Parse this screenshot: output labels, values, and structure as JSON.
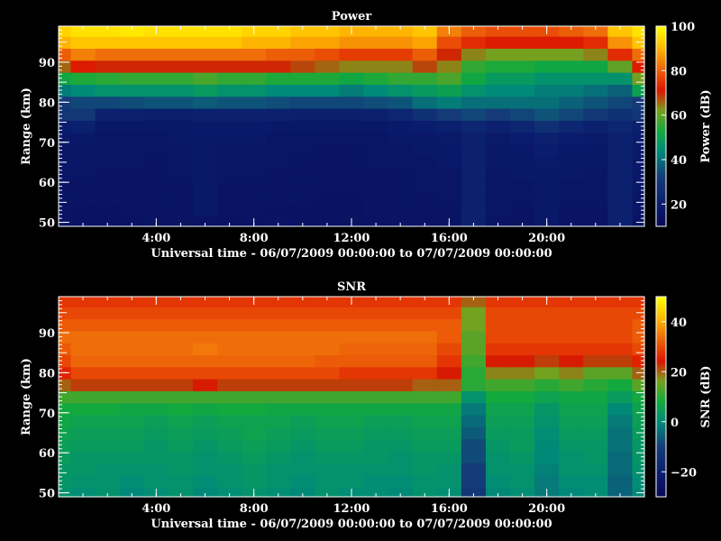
{
  "chart_data": [
    {
      "type": "heatmap",
      "title": "Power",
      "xlabel": "Universal time - 06/07/2009 00:00:00 to 07/07/2009 00:00:00",
      "ylabel": "Range (km)",
      "x_range_hours": [
        0,
        24
      ],
      "ylim": [
        49,
        99
      ],
      "x_ticks": [
        {
          "v": 4,
          "label": "4:00"
        },
        {
          "v": 8,
          "label": "8:00"
        },
        {
          "v": 12,
          "label": "12:00"
        },
        {
          "v": 16,
          "label": "16:00"
        },
        {
          "v": 20,
          "label": "20:00"
        }
      ],
      "y_ticks": [
        {
          "v": 50,
          "label": "50"
        },
        {
          "v": 60,
          "label": "60"
        },
        {
          "v": 70,
          "label": "70"
        },
        {
          "v": 80,
          "label": "80"
        },
        {
          "v": 90,
          "label": "90"
        }
      ],
      "colorbar": {
        "label": "Power (dB)",
        "range": [
          10,
          100
        ],
        "ticks": [
          {
            "v": 20,
            "label": "20"
          },
          {
            "v": 40,
            "label": "40"
          },
          {
            "v": 60,
            "label": "60"
          },
          {
            "v": 80,
            "label": "80"
          },
          {
            "v": 100,
            "label": "100"
          }
        ]
      },
      "range_gates_km": [
        50,
        53,
        56,
        59,
        62,
        65,
        68,
        71,
        74,
        77,
        80,
        83,
        86,
        89,
        92,
        95,
        98
      ],
      "times_hours": [
        0,
        1,
        2,
        3,
        4,
        5,
        6,
        7,
        8,
        9,
        10,
        11,
        12,
        13,
        14,
        15,
        16,
        17,
        18,
        19,
        20,
        21,
        22,
        23,
        24
      ],
      "z": [
        [
          15,
          15,
          15,
          15,
          16,
          16,
          15,
          15,
          15,
          16,
          15,
          15,
          15,
          15,
          16,
          15,
          16,
          22,
          16,
          16,
          18,
          16,
          16,
          22,
          16
        ],
        [
          16,
          15,
          15,
          16,
          16,
          16,
          18,
          16,
          16,
          15,
          15,
          15,
          15,
          16,
          16,
          16,
          16,
          22,
          17,
          16,
          18,
          16,
          16,
          22,
          17
        ],
        [
          16,
          16,
          16,
          16,
          16,
          16,
          18,
          16,
          16,
          16,
          16,
          15,
          15,
          16,
          16,
          16,
          17,
          22,
          17,
          17,
          18,
          17,
          17,
          22,
          17
        ],
        [
          16,
          16,
          16,
          16,
          16,
          16,
          18,
          16,
          16,
          16,
          16,
          16,
          16,
          16,
          16,
          17,
          17,
          22,
          17,
          17,
          18,
          17,
          17,
          22,
          18
        ],
        [
          17,
          17,
          16,
          16,
          16,
          17,
          18,
          17,
          17,
          16,
          16,
          16,
          16,
          16,
          16,
          17,
          17,
          22,
          17,
          18,
          18,
          18,
          17,
          22,
          18
        ],
        [
          17,
          17,
          17,
          17,
          16,
          17,
          18,
          17,
          17,
          17,
          16,
          16,
          16,
          17,
          17,
          17,
          18,
          22,
          18,
          18,
          19,
          18,
          18,
          22,
          18
        ],
        [
          17,
          17,
          17,
          17,
          17,
          17,
          18,
          17,
          17,
          17,
          17,
          16,
          16,
          17,
          17,
          18,
          18,
          22,
          18,
          18,
          20,
          18,
          18,
          22,
          19
        ],
        [
          18,
          18,
          17,
          17,
          17,
          18,
          18,
          18,
          18,
          17,
          17,
          17,
          17,
          17,
          18,
          18,
          19,
          22,
          19,
          20,
          22,
          20,
          19,
          22,
          20
        ],
        [
          20,
          22,
          18,
          18,
          18,
          18,
          19,
          19,
          19,
          18,
          18,
          18,
          18,
          18,
          19,
          20,
          21,
          24,
          22,
          24,
          28,
          24,
          22,
          24,
          22
        ],
        [
          30,
          30,
          22,
          22,
          21,
          21,
          22,
          22,
          22,
          22,
          21,
          21,
          21,
          22,
          24,
          28,
          32,
          34,
          32,
          34,
          36,
          34,
          30,
          28,
          30
        ],
        [
          32,
          34,
          34,
          35,
          36,
          36,
          37,
          36,
          36,
          35,
          34,
          34,
          34,
          35,
          36,
          40,
          42,
          40,
          40,
          40,
          40,
          38,
          36,
          34,
          32
        ],
        [
          42,
          44,
          46,
          46,
          46,
          46,
          48,
          46,
          46,
          44,
          44,
          44,
          42,
          44,
          46,
          48,
          50,
          46,
          44,
          44,
          42,
          42,
          40,
          38,
          50
        ],
        [
          52,
          54,
          55,
          56,
          56,
          56,
          58,
          56,
          56,
          54,
          54,
          54,
          52,
          54,
          56,
          56,
          58,
          52,
          48,
          48,
          46,
          46,
          46,
          46,
          62
        ],
        [
          66,
          72,
          70,
          70,
          70,
          70,
          70,
          70,
          70,
          70,
          68,
          66,
          64,
          64,
          64,
          68,
          64,
          56,
          54,
          54,
          52,
          52,
          52,
          60,
          72
        ],
        [
          80,
          84,
          82,
          82,
          82,
          82,
          82,
          82,
          82,
          80,
          80,
          78,
          76,
          76,
          76,
          80,
          70,
          64,
          62,
          62,
          62,
          62,
          64,
          74,
          82
        ],
        [
          90,
          92,
          92,
          92,
          92,
          92,
          92,
          92,
          90,
          90,
          88,
          88,
          86,
          86,
          86,
          88,
          78,
          74,
          72,
          72,
          72,
          72,
          74,
          86,
          92
        ],
        [
          94,
          96,
          96,
          97,
          96,
          96,
          96,
          96,
          94,
          94,
          92,
          92,
          90,
          90,
          90,
          92,
          84,
          80,
          78,
          78,
          78,
          80,
          82,
          92,
          96
        ]
      ]
    },
    {
      "type": "heatmap",
      "title": "SNR",
      "xlabel": "Universal time - 06/07/2009 00:00:00 to 07/07/2009 00:00:00",
      "ylabel": "Range (km)",
      "x_range_hours": [
        0,
        24
      ],
      "ylim": [
        49,
        99
      ],
      "x_ticks": [
        {
          "v": 4,
          "label": "4:00"
        },
        {
          "v": 8,
          "label": "8:00"
        },
        {
          "v": 12,
          "label": "12:00"
        },
        {
          "v": 16,
          "label": "16:00"
        },
        {
          "v": 20,
          "label": "20:00"
        }
      ],
      "y_ticks": [
        {
          "v": 50,
          "label": "50"
        },
        {
          "v": 60,
          "label": "60"
        },
        {
          "v": 70,
          "label": "70"
        },
        {
          "v": 80,
          "label": "80"
        },
        {
          "v": 90,
          "label": "90"
        }
      ],
      "colorbar": {
        "label": "SNR (dB)",
        "range": [
          -30,
          50
        ],
        "ticks": [
          {
            "v": -20,
            "label": "−20"
          },
          {
            "v": 0,
            "label": "0"
          },
          {
            "v": 20,
            "label": "20"
          },
          {
            "v": 40,
            "label": "40"
          }
        ]
      },
      "range_gates_km": [
        50,
        53,
        56,
        59,
        62,
        65,
        68,
        71,
        74,
        77,
        80,
        83,
        86,
        89,
        92,
        95,
        98
      ],
      "times_hours": [
        0,
        1,
        2,
        3,
        4,
        5,
        6,
        7,
        8,
        9,
        10,
        11,
        12,
        13,
        14,
        15,
        16,
        17,
        18,
        19,
        20,
        21,
        22,
        23,
        24
      ],
      "z": [
        [
          2,
          1,
          2,
          0,
          1,
          2,
          0,
          1,
          2,
          1,
          0,
          2,
          1,
          1,
          0,
          2,
          1,
          -12,
          0,
          1,
          -2,
          0,
          1,
          -5,
          0
        ],
        [
          3,
          2,
          2,
          1,
          2,
          2,
          1,
          2,
          3,
          2,
          1,
          2,
          2,
          1,
          1,
          2,
          2,
          -10,
          1,
          2,
          -2,
          1,
          1,
          -5,
          1
        ],
        [
          3,
          3,
          2,
          2,
          2,
          3,
          2,
          2,
          3,
          2,
          2,
          2,
          2,
          2,
          2,
          3,
          2,
          -10,
          2,
          2,
          -1,
          2,
          2,
          -4,
          2
        ],
        [
          4,
          3,
          3,
          3,
          3,
          3,
          2,
          3,
          4,
          3,
          2,
          3,
          3,
          3,
          2,
          3,
          3,
          -8,
          2,
          3,
          0,
          2,
          3,
          -4,
          3
        ],
        [
          5,
          4,
          4,
          4,
          3,
          4,
          3,
          4,
          5,
          4,
          3,
          4,
          4,
          3,
          3,
          4,
          4,
          -8,
          3,
          4,
          0,
          3,
          3,
          -3,
          3
        ],
        [
          6,
          5,
          5,
          5,
          4,
          5,
          4,
          5,
          6,
          5,
          4,
          5,
          5,
          4,
          4,
          5,
          5,
          -6,
          4,
          4,
          1,
          4,
          4,
          -3,
          4
        ],
        [
          7,
          6,
          6,
          6,
          5,
          6,
          5,
          6,
          6,
          6,
          5,
          6,
          6,
          5,
          5,
          6,
          6,
          -4,
          5,
          5,
          2,
          5,
          5,
          -2,
          5
        ],
        [
          8,
          8,
          8,
          7,
          7,
          8,
          7,
          8,
          8,
          7,
          7,
          7,
          7,
          7,
          7,
          7,
          7,
          -2,
          6,
          6,
          3,
          6,
          6,
          0,
          6
        ],
        [
          12,
          12,
          12,
          12,
          12,
          12,
          12,
          12,
          12,
          12,
          12,
          12,
          12,
          12,
          12,
          12,
          12,
          2,
          8,
          8,
          6,
          7,
          7,
          4,
          8
        ],
        [
          20,
          22,
          22,
          22,
          22,
          22,
          24,
          22,
          22,
          22,
          22,
          22,
          22,
          22,
          22,
          20,
          20,
          10,
          12,
          12,
          10,
          12,
          10,
          8,
          14
        ],
        [
          26,
          30,
          30,
          30,
          30,
          30,
          30,
          30,
          30,
          30,
          30,
          30,
          28,
          28,
          28,
          28,
          24,
          10,
          18,
          18,
          16,
          18,
          14,
          14,
          20
        ],
        [
          30,
          33,
          33,
          33,
          33,
          33,
          33,
          33,
          33,
          33,
          33,
          32,
          32,
          32,
          32,
          32,
          28,
          12,
          24,
          24,
          22,
          24,
          22,
          22,
          26
        ],
        [
          32,
          34,
          34,
          34,
          34,
          34,
          35,
          34,
          34,
          34,
          34,
          34,
          33,
          33,
          33,
          33,
          30,
          14,
          28,
          28,
          28,
          28,
          28,
          28,
          30
        ],
        [
          34,
          34,
          34,
          34,
          34,
          34,
          34,
          34,
          34,
          34,
          34,
          34,
          34,
          34,
          34,
          34,
          32,
          14,
          30,
          30,
          30,
          30,
          30,
          30,
          32
        ],
        [
          32,
          32,
          32,
          32,
          32,
          32,
          32,
          32,
          32,
          32,
          32,
          32,
          32,
          32,
          32,
          32,
          32,
          16,
          30,
          30,
          30,
          30,
          30,
          30,
          32
        ],
        [
          30,
          30,
          30,
          30,
          30,
          30,
          30,
          30,
          30,
          30,
          30,
          30,
          30,
          30,
          30,
          30,
          30,
          16,
          30,
          30,
          30,
          30,
          30,
          30,
          30
        ],
        [
          28,
          28,
          28,
          28,
          28,
          28,
          28,
          28,
          28,
          28,
          28,
          28,
          28,
          28,
          28,
          28,
          28,
          20,
          28,
          28,
          28,
          28,
          28,
          28,
          28
        ]
      ]
    }
  ]
}
